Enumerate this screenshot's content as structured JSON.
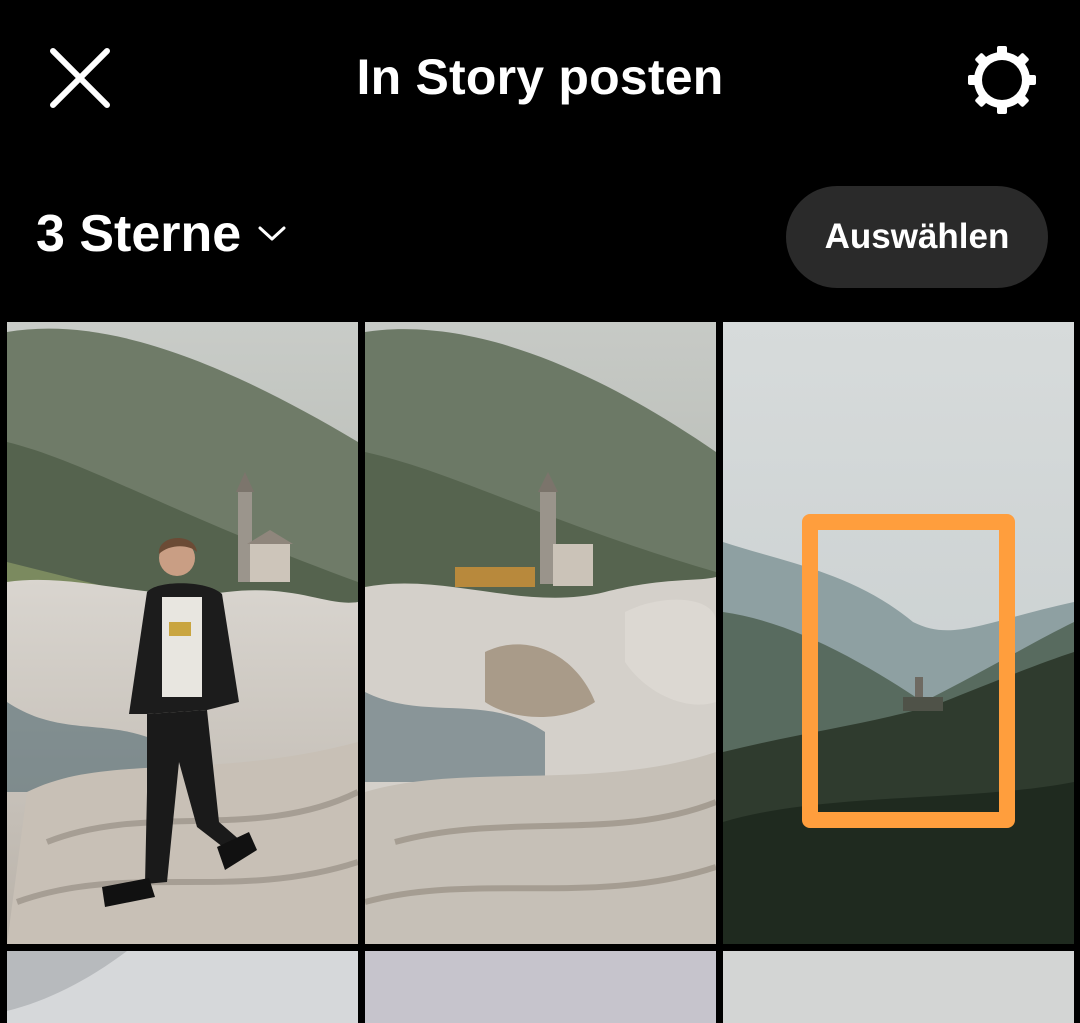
{
  "header": {
    "title": "In Story posten",
    "close_icon": "close-icon",
    "settings_icon": "settings-icon"
  },
  "album": {
    "label": "3 Sterne",
    "dropdown_icon": "chevron-down-icon",
    "select_button": "Auswählen"
  },
  "colors": {
    "background": "#000000",
    "button_bg": "#2a2a2a",
    "highlight": "#ff9e3d",
    "text": "#ffffff"
  },
  "photos": [
    {
      "id": "photo-1",
      "description": "woman walking on rocks in valley"
    },
    {
      "id": "photo-2",
      "description": "rocky riverbank with village and church tower"
    },
    {
      "id": "photo-3",
      "description": "misty mountain valley with church on hill"
    },
    {
      "id": "photo-4",
      "description": "cloudy sky"
    },
    {
      "id": "photo-5",
      "description": "grey sky"
    },
    {
      "id": "photo-6",
      "description": "pale sky"
    }
  ]
}
